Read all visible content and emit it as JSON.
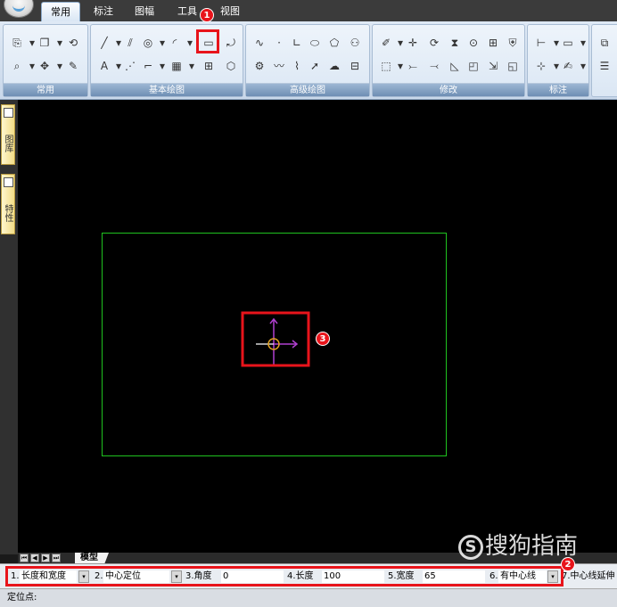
{
  "tabs": [
    "常用",
    "标注",
    "图幅",
    "工具",
    "视图"
  ],
  "ribbon": {
    "panels": [
      "常用",
      "基本绘图",
      "高级绘图",
      "修改",
      "标注"
    ]
  },
  "sidebar": {
    "items": [
      "图库",
      "特性"
    ]
  },
  "model_tab": "模型",
  "markers": [
    "1",
    "2",
    "3"
  ],
  "command_bar": {
    "f1_label": "1.",
    "f1_value": "长度和宽度",
    "f2_label": "2.",
    "f2_value": "中心定位",
    "f3_label": "3.角度",
    "f3_value": "0",
    "f4_label": "4.长度",
    "f4_value": "100",
    "f5_label": "5.宽度",
    "f5_value": "65",
    "f6_label": "6.",
    "f6_value": "有中心线",
    "f7_label": "7.中心线延伸"
  },
  "status_prompt": "定位点:",
  "watermark": {
    "circle": "S",
    "text": "搜狗指南"
  },
  "colors": {
    "highlight": "#e8141b",
    "rectangle": "#1fc21f",
    "axis_vertical": "#b040d0",
    "axis_horizontal": "#ffffff",
    "cursor_circle": "#e0a020"
  }
}
